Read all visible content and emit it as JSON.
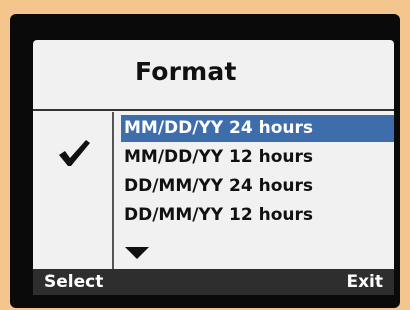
{
  "screen": {
    "title": "Format",
    "options": [
      {
        "label": "MM/DD/YY 24 hours",
        "highlighted": true,
        "checked": false
      },
      {
        "label": "MM/DD/YY 12 hours",
        "highlighted": false,
        "checked": true
      },
      {
        "label": "DD/MM/YY 24 hours",
        "highlighted": false,
        "checked": false
      },
      {
        "label": "DD/MM/YY 12 hours",
        "highlighted": false,
        "checked": false
      }
    ],
    "icons": {
      "check": "checkmark-icon",
      "more": "arrow-down-icon"
    }
  },
  "softkeys": {
    "left_label": "Select",
    "right_label": "Exit"
  },
  "colors": {
    "highlight": "#3d6dab",
    "background": "#f1f1f1",
    "bezel": "#0a0a0a",
    "frame": "#f4c58d",
    "softkey_bar": "#2e2e2e"
  }
}
